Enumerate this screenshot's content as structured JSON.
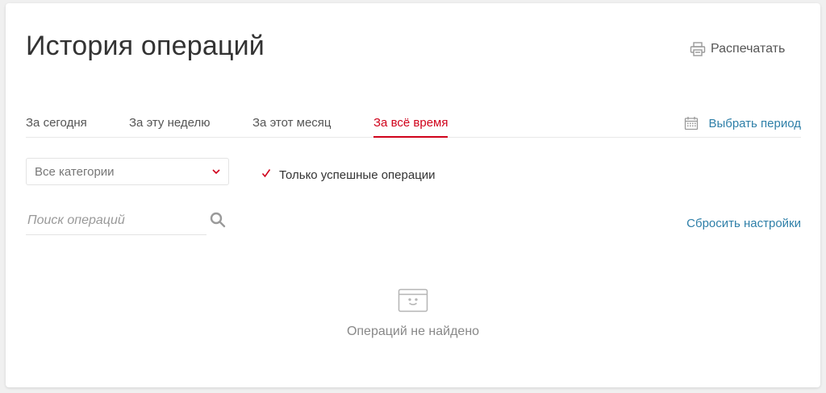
{
  "page": {
    "title": "История операций"
  },
  "header": {
    "print_label": "Распечатать",
    "print_icon": "printer-icon"
  },
  "tabs": [
    {
      "label": "За сегодня",
      "active": false
    },
    {
      "label": "За эту неделю",
      "active": false
    },
    {
      "label": "За этот месяц",
      "active": false
    },
    {
      "label": "За всё время",
      "active": true
    }
  ],
  "period": {
    "label": "Выбрать период",
    "icon": "calendar-icon"
  },
  "filters": {
    "category_selected": "Все категории",
    "category_icon": "chevron-down-icon",
    "success_only_label": "Только успешные операции",
    "success_only_checked": true,
    "search_placeholder": "Поиск операций",
    "search_value": "",
    "search_icon": "search-icon",
    "reset_label": "Сбросить настройки"
  },
  "empty_state": {
    "icon": "empty-box-icon",
    "message": "Операций не найдено"
  },
  "colors": {
    "accent_red": "#d0021b",
    "link_blue": "#2e7fa8",
    "text_dark": "#333333",
    "text_muted": "#888888"
  }
}
